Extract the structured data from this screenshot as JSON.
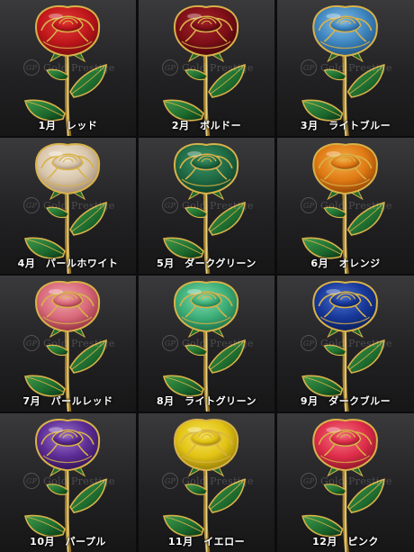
{
  "watermark": {
    "text": "Gold Prestige",
    "seal": "GP"
  },
  "roses": [
    {
      "label": "1月　レッド",
      "petal": "#c0171c",
      "petal_light": "#e4413a",
      "petal_dark": "#6e0a0c"
    },
    {
      "label": "2月　ボルドー",
      "petal": "#7e0f18",
      "petal_light": "#a8242c",
      "petal_dark": "#3e0508"
    },
    {
      "label": "3月　ライトブルー",
      "petal": "#3f86c0",
      "petal_light": "#8cc3e8",
      "petal_dark": "#1d4f7c"
    },
    {
      "label": "4月　パールホワイト",
      "petal": "#d9c7ad",
      "petal_light": "#f4eadc",
      "petal_dark": "#9a836a"
    },
    {
      "label": "5月　ダークグリーン",
      "petal": "#1f6a45",
      "petal_light": "#3f9468",
      "petal_dark": "#0c3a22"
    },
    {
      "label": "6月　オレンジ",
      "petal": "#e07a14",
      "petal_light": "#f5b24a",
      "petal_dark": "#8a3e05"
    },
    {
      "label": "7月　パールレッド",
      "petal": "#d8697a",
      "petal_light": "#f2a8b0",
      "petal_dark": "#8a2a38"
    },
    {
      "label": "8月　ライトグリーン",
      "petal": "#3cae78",
      "petal_light": "#86dcae",
      "petal_dark": "#1b6a42"
    },
    {
      "label": "9月　ダークブルー",
      "petal": "#17389a",
      "petal_light": "#4c74d0",
      "petal_dark": "#0a1b52"
    },
    {
      "label": "10月　パープル",
      "petal": "#5d2d96",
      "petal_light": "#a07ad2",
      "petal_dark": "#2c104e"
    },
    {
      "label": "11月　イエロー",
      "petal": "#e2c314",
      "petal_light": "#f7e660",
      "petal_dark": "#8c7405"
    },
    {
      "label": "12月　ピンク",
      "petal": "#df2d4a",
      "petal_light": "#f27886",
      "petal_dark": "#841424"
    }
  ],
  "colors": {
    "gold": "#d8b24a",
    "gold_light": "#f6e39a",
    "leaf": "#1d6a2e",
    "leaf_light": "#3f9a4c",
    "leaf_dark": "#0a3414"
  }
}
